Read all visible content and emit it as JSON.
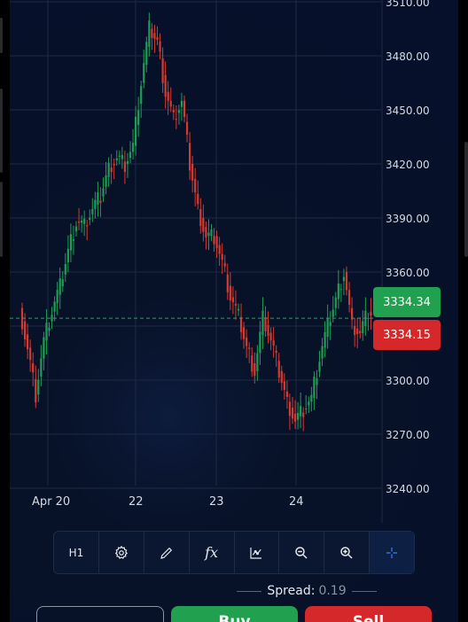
{
  "chart": {
    "price_levels": [
      "3510.00",
      "3480.00",
      "3450.00",
      "3420.00",
      "3390.00",
      "3360.00",
      "3300.00",
      "3270.00",
      "3240.00"
    ],
    "date_labels": [
      "Apr 20",
      "22",
      "23",
      "24"
    ],
    "ask_price": "3334.34",
    "bid_price": "3334.15",
    "colors": {
      "up": "#1f9d55",
      "down": "#d63a2f",
      "ask_tag": "#21a050",
      "bid_tag": "#d4282a",
      "dashed": "#1fa85a"
    }
  },
  "chart_data": {
    "type": "candlestick",
    "y_range": [
      3240,
      3510
    ],
    "y_ticks": [
      3510,
      3480,
      3450,
      3420,
      3390,
      3360,
      3300,
      3270,
      3240
    ],
    "x_tick_labels": [
      "Apr 20",
      "22",
      "23",
      "24"
    ],
    "current_ask": 3334.34,
    "current_bid": 3334.15,
    "close_path": [
      3340,
      3318,
      3292,
      3322,
      3338,
      3352,
      3372,
      3388,
      3386,
      3395,
      3402,
      3418,
      3424,
      3420,
      3430,
      3465,
      3495,
      3488,
      3460,
      3445,
      3455,
      3420,
      3395,
      3380,
      3380,
      3365,
      3346,
      3335,
      3318,
      3305,
      3335,
      3322,
      3305,
      3288,
      3278,
      3284,
      3290,
      3312,
      3330,
      3345,
      3360,
      3330,
      3326,
      3338,
      3334,
      3325,
      3330,
      3334
    ]
  },
  "toolbar": {
    "timeframe": "H1",
    "icons": [
      "settings-icon",
      "pencil-icon",
      "fx-icon",
      "indicator-chart-icon",
      "zoom-out-icon",
      "zoom-in-icon",
      "crosshair-icon"
    ],
    "fx_label": "fx"
  },
  "spread": {
    "label": "Spread:",
    "value": "0.19"
  },
  "buttons": {
    "buy": "Buy",
    "sell": "Sell"
  }
}
